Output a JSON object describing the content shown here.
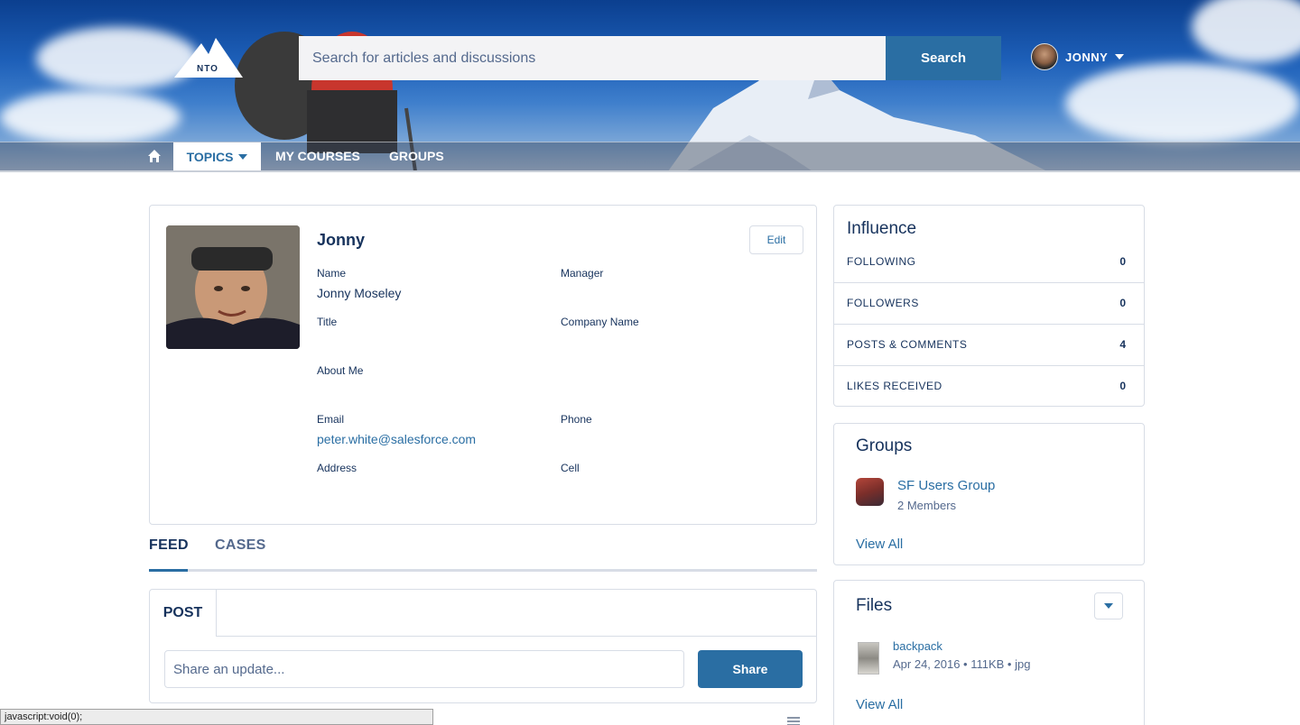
{
  "header": {
    "logo_text": "NTO",
    "search_placeholder": "Search for articles and discussions",
    "search_button": "Search",
    "user_name": "JONNY"
  },
  "nav": {
    "items": [
      {
        "label": "TOPICS",
        "active": true,
        "has_dropdown": true
      },
      {
        "label": "MY COURSES"
      },
      {
        "label": "GROUPS"
      }
    ]
  },
  "profile": {
    "display_name": "Jonny",
    "edit_label": "Edit",
    "fields": {
      "name_label": "Name",
      "name_value": "Jonny Moseley",
      "manager_label": "Manager",
      "title_label": "Title",
      "company_label": "Company Name",
      "about_label": "About Me",
      "email_label": "Email",
      "email_value": "peter.white@salesforce.com",
      "phone_label": "Phone",
      "address_label": "Address",
      "cell_label": "Cell"
    }
  },
  "tabs": {
    "feed": "FEED",
    "cases": "CASES"
  },
  "post": {
    "tab_label": "POST",
    "input_placeholder": "Share an update...",
    "share_button": "Share"
  },
  "influence": {
    "title": "Influence",
    "rows": [
      {
        "label": "FOLLOWING",
        "value": "0"
      },
      {
        "label": "FOLLOWERS",
        "value": "0"
      },
      {
        "label": "POSTS & COMMENTS",
        "value": "4"
      },
      {
        "label": "LIKES RECEIVED",
        "value": "0"
      }
    ]
  },
  "groups": {
    "title": "Groups",
    "items": [
      {
        "name": "SF Users Group",
        "members": "2 Members"
      }
    ],
    "view_all": "View All"
  },
  "files": {
    "title": "Files",
    "items": [
      {
        "name": "backpack",
        "meta": "Apr 24, 2016 • 111KB • jpg"
      }
    ],
    "view_all": "View All"
  },
  "statusbar": {
    "text": "javascript:void(0);"
  },
  "colors": {
    "brand": "#2a6ea3",
    "text": "#16325c",
    "muted": "#54698d",
    "border": "#d8dde6"
  }
}
